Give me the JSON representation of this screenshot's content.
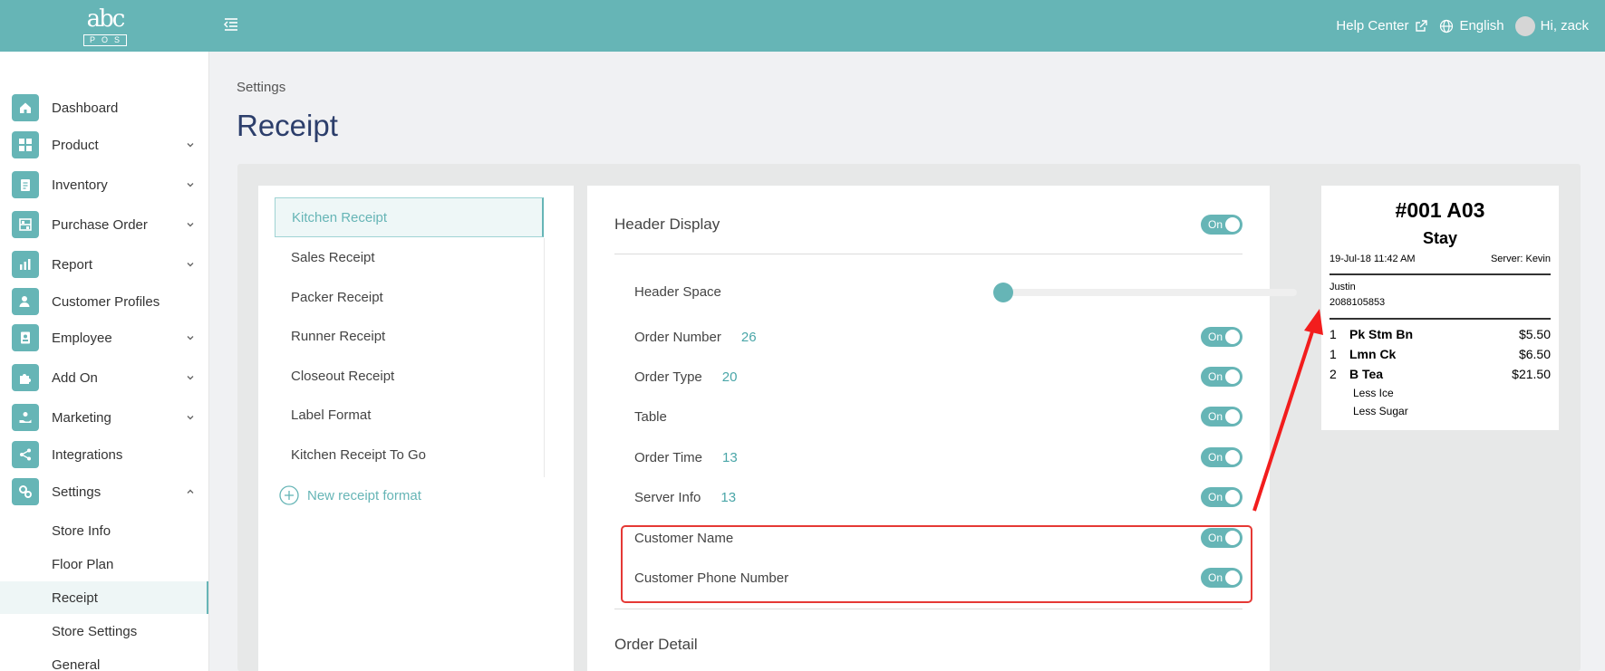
{
  "header": {
    "logo_top": "abc",
    "logo_bottom": "POS",
    "help_center": "Help Center",
    "language": "English",
    "greeting": "Hi, zack"
  },
  "sidebar": {
    "items": [
      {
        "label": "Dashboard"
      },
      {
        "label": "Product"
      },
      {
        "label": "Inventory"
      },
      {
        "label": "Purchase Order"
      },
      {
        "label": "Report"
      },
      {
        "label": "Customer Profiles"
      },
      {
        "label": "Employee"
      },
      {
        "label": "Add On"
      },
      {
        "label": "Marketing"
      },
      {
        "label": "Integrations"
      },
      {
        "label": "Settings"
      }
    ],
    "settings_sub": [
      {
        "label": "Store Info"
      },
      {
        "label": "Floor Plan"
      },
      {
        "label": "Receipt"
      },
      {
        "label": "Store Settings"
      },
      {
        "label": "General"
      }
    ]
  },
  "page": {
    "breadcrumb": "Settings",
    "title": "Receipt"
  },
  "receipt_types": {
    "items": [
      {
        "label": "Kitchen Receipt"
      },
      {
        "label": "Sales Receipt"
      },
      {
        "label": "Packer Receipt"
      },
      {
        "label": "Runner Receipt"
      },
      {
        "label": "Closeout Receipt"
      },
      {
        "label": "Label Format"
      },
      {
        "label": "Kitchen Receipt To Go"
      }
    ],
    "new_label": "New receipt format"
  },
  "settings": {
    "header_display": "Header Display",
    "header_display_toggle": "On",
    "header_space": "Header Space",
    "header_space_value": 0.03,
    "rows": [
      {
        "label": "Order Number",
        "count": "26",
        "toggle": "On"
      },
      {
        "label": "Order Type",
        "count": "20",
        "toggle": "On"
      },
      {
        "label": "Table",
        "count": "",
        "toggle": "On"
      },
      {
        "label": "Order Time",
        "count": "13",
        "toggle": "On"
      },
      {
        "label": "Server Info",
        "count": "13",
        "toggle": "On"
      },
      {
        "label": "Customer Name",
        "count": "",
        "toggle": "On"
      },
      {
        "label": "Customer Phone Number",
        "count": "",
        "toggle": "On"
      }
    ],
    "order_detail": "Order Detail"
  },
  "receipt_preview": {
    "order": "#001 A03",
    "type": "Stay",
    "datetime": "19-Jul-18 11:42 AM",
    "server": "Server: Kevin",
    "customer_name": "Justin",
    "customer_phone": "2088105853",
    "items": [
      {
        "qty": "1",
        "name": "Pk Stm Bn",
        "price": "$5.50"
      },
      {
        "qty": "1",
        "name": "Lmn Ck",
        "price": "$6.50"
      },
      {
        "qty": "2",
        "name": "B Tea",
        "price": "$21.50"
      }
    ],
    "modifiers": [
      "Less Ice",
      "Less Sugar"
    ]
  },
  "colors": {
    "brand": "#66b5b6",
    "title": "#2c3e6b",
    "annotation": "#e53935"
  }
}
